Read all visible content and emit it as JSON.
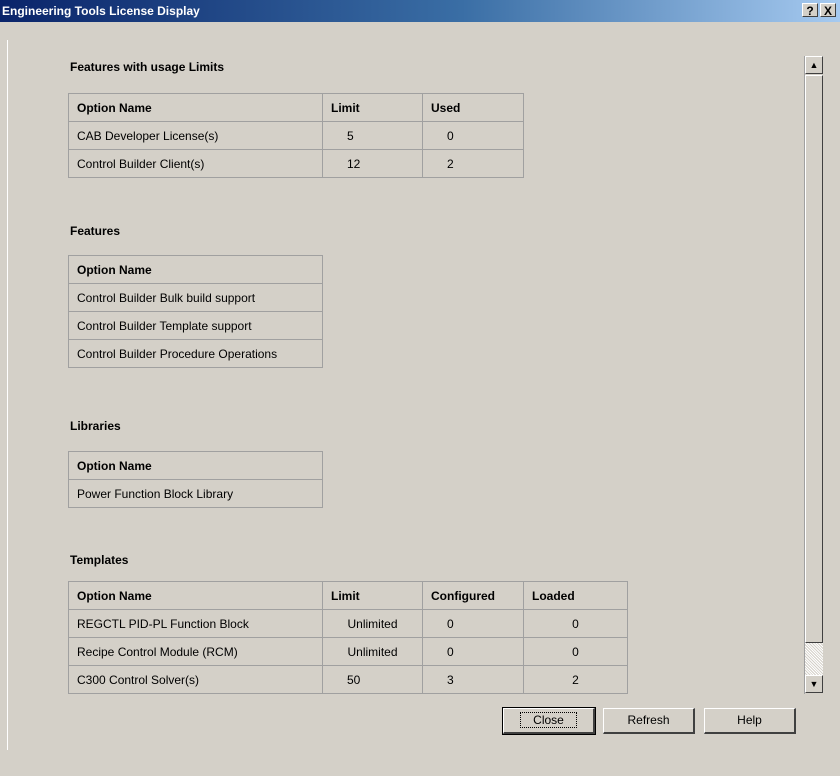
{
  "window": {
    "title": "Engineering Tools License Display",
    "help_glyph": "?",
    "close_glyph": "X"
  },
  "sections": {
    "limits": {
      "title": "Features with usage Limits",
      "headers": [
        "Option Name",
        "Limit",
        "Used"
      ],
      "rows": [
        [
          "CAB Developer License(s)",
          "5",
          "0"
        ],
        [
          "Control Builder Client(s)",
          "12",
          "2"
        ]
      ]
    },
    "features": {
      "title": "Features",
      "headers": [
        "Option Name"
      ],
      "rows": [
        [
          "Control Builder Bulk build support"
        ],
        [
          "Control Builder Template support"
        ],
        [
          "Control Builder Procedure Operations"
        ]
      ]
    },
    "libraries": {
      "title": "Libraries",
      "headers": [
        "Option Name"
      ],
      "rows": [
        [
          "Power Function Block Library"
        ]
      ]
    },
    "templates": {
      "title": "Templates",
      "headers": [
        "Option Name",
        "Limit",
        "Configured",
        "Loaded"
      ],
      "rows": [
        [
          "REGCTL PID-PL Function Block",
          "Unlimited",
          "0",
          "0"
        ],
        [
          "Recipe Control Module (RCM)",
          "Unlimited",
          "0",
          "0"
        ],
        [
          "C300 Control Solver(s)",
          "50",
          "3",
          "2"
        ]
      ]
    }
  },
  "buttons": {
    "close": "Close",
    "refresh": "Refresh",
    "help": "Help"
  },
  "icons": {
    "scroll_up": "up-arrow",
    "scroll_down": "down-arrow"
  }
}
